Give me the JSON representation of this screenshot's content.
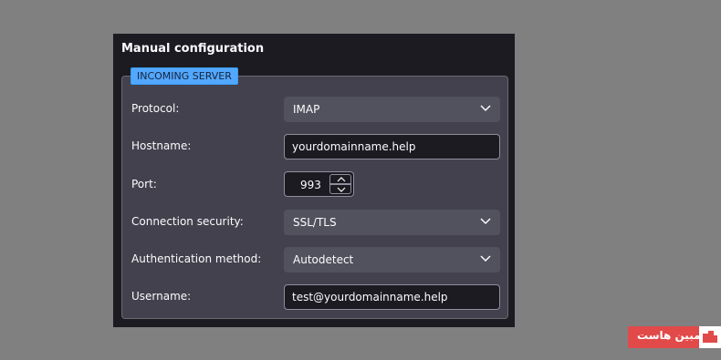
{
  "panel": {
    "title": "Manual configuration"
  },
  "incoming": {
    "legend": "INCOMING SERVER",
    "protocol": {
      "label": "Protocol:",
      "value": "IMAP"
    },
    "hostname": {
      "label": "Hostname:",
      "value": "yourdomainname.help"
    },
    "port": {
      "label": "Port:",
      "value": "993"
    },
    "security": {
      "label": "Connection security:",
      "value": "SSL/TLS"
    },
    "auth": {
      "label": "Authentication method:",
      "value": "Autodetect"
    },
    "username": {
      "label": "Username:",
      "value": "test@yourdomainname.help"
    }
  },
  "watermark": {
    "text": "مبین هاست"
  },
  "icons": [
    "chevron-down-icon",
    "spin-up-icon",
    "spin-down-icon",
    "brand-logo-icon"
  ],
  "colors": {
    "background": "#808080",
    "panel": "#1c1b22",
    "fieldset": "#42414d",
    "legend": "#52a7ff",
    "watermark": "#e24a4a"
  }
}
